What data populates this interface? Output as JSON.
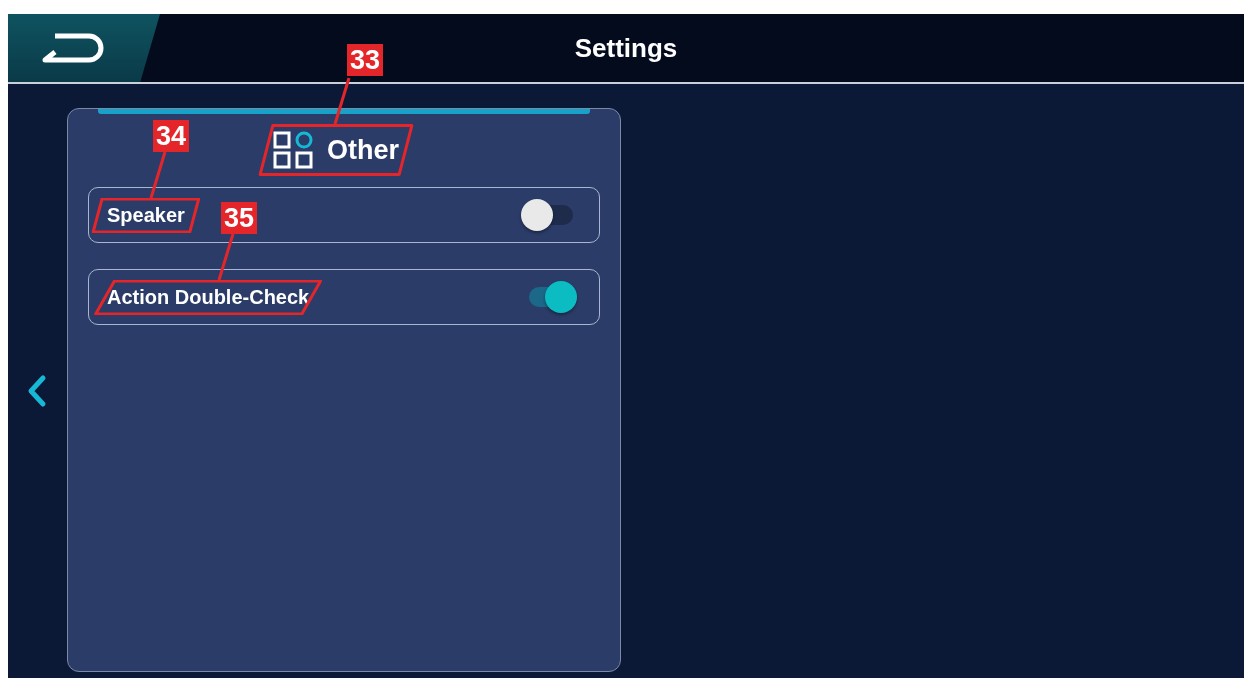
{
  "header": {
    "title": "Settings"
  },
  "panel": {
    "title": "Other",
    "callout": "33"
  },
  "items": [
    {
      "label": "Speaker",
      "on": false,
      "callout": "34"
    },
    {
      "label": "Action Double-Check",
      "on": true,
      "callout": "35"
    }
  ]
}
